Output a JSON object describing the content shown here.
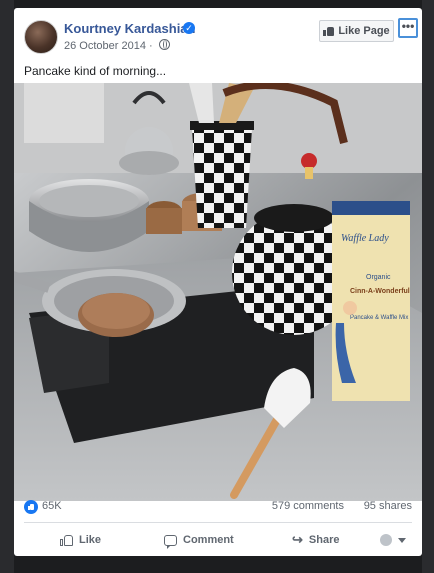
{
  "post": {
    "author": "Kourtney Kardashian",
    "date": "26 October 2014",
    "caption": "Pancake kind of morning...",
    "like_page_label": "Like Page",
    "more_label": "•••"
  },
  "photo": {
    "box_brand": "Waffle Lady",
    "box_product": "Cinn-A-Wonderful",
    "box_sub": "Pancake & Waffle Mix",
    "box_organic": "Organic"
  },
  "reactions": {
    "count": "65K",
    "comments": "579 comments",
    "shares": "95 shares"
  },
  "actions": {
    "like": "Like",
    "comment": "Comment",
    "share": "Share"
  },
  "icons": {
    "verified": "verified-badge-icon",
    "privacy": "globe-icon",
    "like_reaction": "like-reaction-icon",
    "share": "share-arrow-icon"
  },
  "colors": {
    "author_link": "#385898",
    "accent": "#1877f2",
    "background": "#1c1d1f"
  }
}
